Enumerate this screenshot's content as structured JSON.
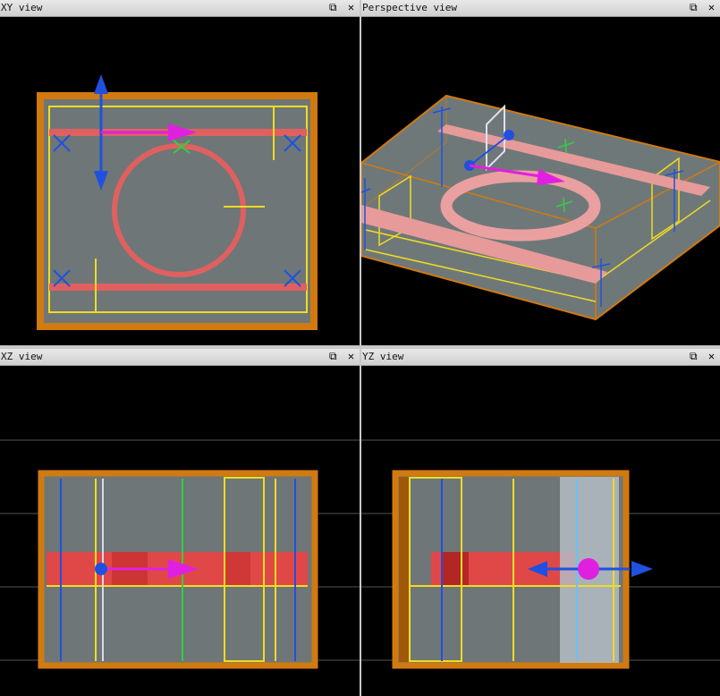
{
  "panes": {
    "xy": {
      "title": "XY view"
    },
    "persp": {
      "title": "Perspective view"
    },
    "xz": {
      "title": "XZ view"
    },
    "yz": {
      "title": "YZ view"
    }
  },
  "buttons": {
    "restore_glyph": "⧉",
    "close_glyph": "✕"
  },
  "icons": {
    "restore": "restore-window-icon",
    "close": "close-icon"
  },
  "colors": {
    "background": "#000000",
    "substrate_border": "#d07a10",
    "substrate_fill": "#6e7677",
    "waveguide": "#e06060",
    "guide_yellow": "#f0dc20",
    "axis_blue": "#2050e0",
    "axis_magenta": "#e020e0",
    "marker_green": "#30d040"
  }
}
